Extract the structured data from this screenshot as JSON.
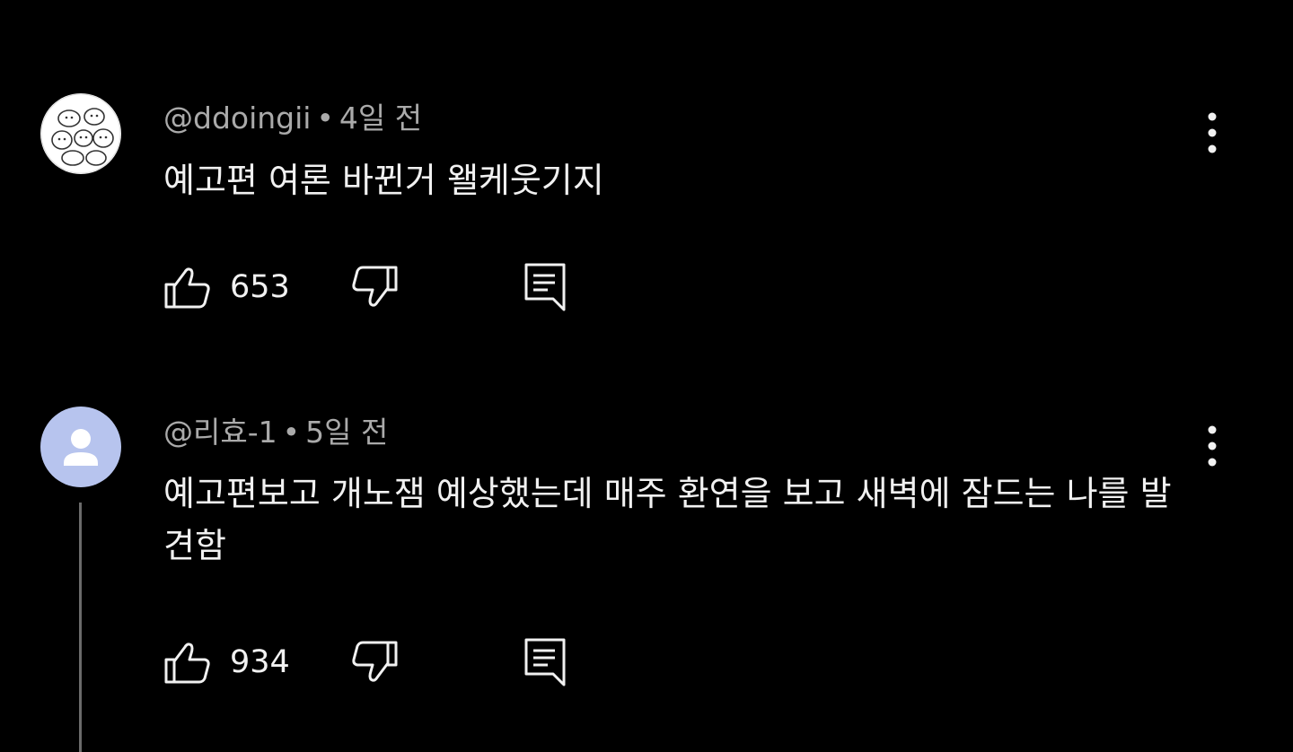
{
  "comments": [
    {
      "handle": "@ddoingii",
      "separator": "•",
      "time": "4일 전",
      "text": "예고편 여론 바뀐거 왤케웃기지",
      "likes": "653"
    },
    {
      "handle": "@리효-1",
      "separator": "•",
      "time": "5일 전",
      "text": "예고편보고 개노잼 예상했는데 매주 환연을 보고 새벽에 잠드는 나를 발견함",
      "likes": "934"
    }
  ],
  "icons": {
    "like": "thumbs-up-icon",
    "dislike": "thumbs-down-icon",
    "reply": "reply-comment-icon",
    "more": "more-vert-icon",
    "avatar_default": "person-silhouette-icon"
  },
  "colors": {
    "background": "#000000",
    "meta_text": "#aaaaaa",
    "body_text": "#f1f1f1",
    "default_avatar": "#b7c4ee"
  }
}
